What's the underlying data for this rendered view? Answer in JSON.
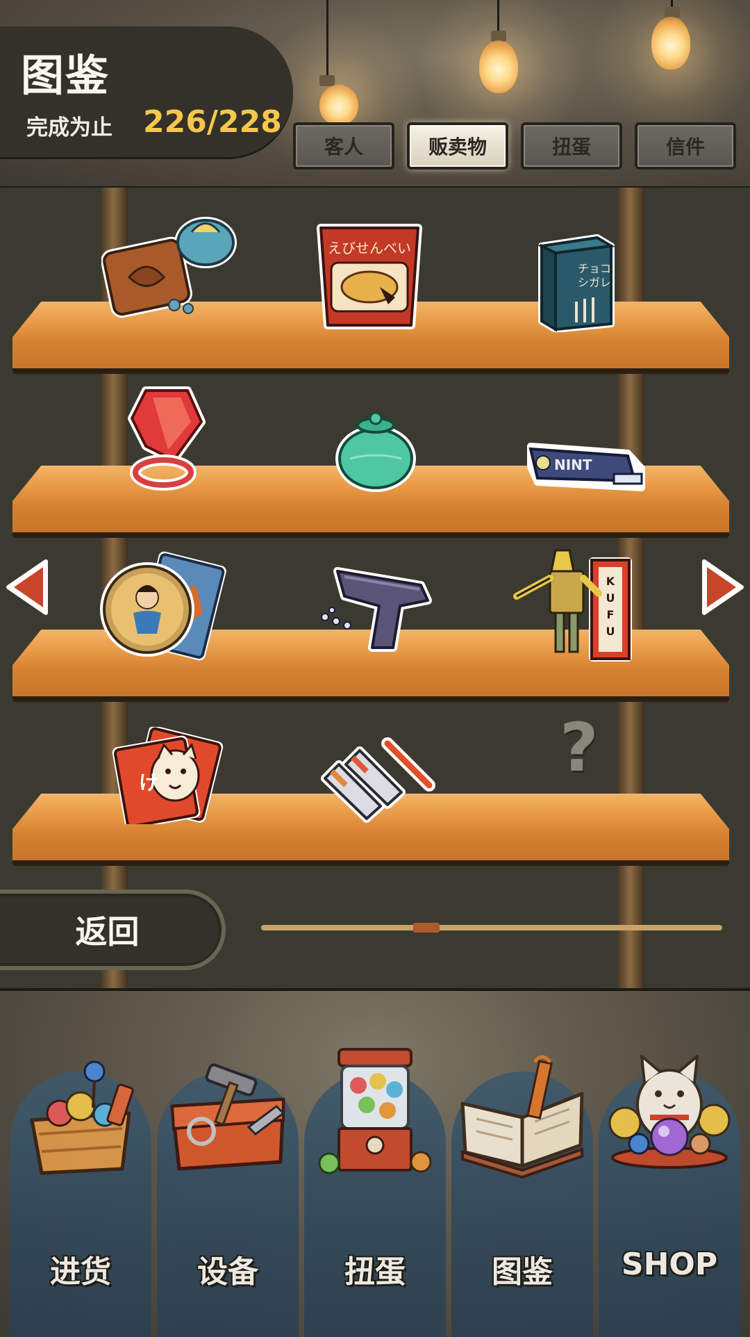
{
  "header": {
    "title": "图鉴",
    "progress_label": "完成为止",
    "progress_value": "226/228",
    "progress_color": "#f5c84a"
  },
  "tabs": [
    {
      "label": "客人",
      "active": false
    },
    {
      "label": "贩卖物",
      "active": true
    },
    {
      "label": "扭蛋",
      "active": false
    },
    {
      "label": "信件",
      "active": false
    }
  ],
  "shelves": [
    {
      "items": [
        "wagashi-owl-candy",
        "senbei-snack-bag",
        "chocolate-cigarette-box"
      ]
    },
    {
      "items": [
        "ring-pop-candy",
        "green-candy-jar",
        "mint-tablet-pack"
      ]
    },
    {
      "items": [
        "hero-menko-card",
        "toy-water-pistol",
        "pharaoh-robot-toy"
      ]
    },
    {
      "items": [
        "cat-face-playing-cards",
        "paint-tube-set",
        "unknown-item"
      ]
    }
  ],
  "shelf_labels": {
    "chocolate_box": "チョコシガレ",
    "mint_pack": "NINT",
    "robot_box": "KUFU",
    "unknown": "?"
  },
  "navigation": {
    "prev_arrow": "left-arrow-icon",
    "next_arrow": "right-arrow-icon",
    "back_label": "返回",
    "page_position": 0.35
  },
  "bottom_nav": [
    {
      "label": "进货",
      "icon": "goods-basket-icon"
    },
    {
      "label": "设备",
      "icon": "toolbox-icon"
    },
    {
      "label": "扭蛋",
      "icon": "gachapon-machine-icon"
    },
    {
      "label": "图鉴",
      "icon": "open-book-icon"
    },
    {
      "label": "SHOP",
      "icon": "lucky-cat-icon"
    }
  ],
  "colors": {
    "accent_red": "#c8452a",
    "wood": "#e89b48",
    "panel": "#34312b"
  }
}
